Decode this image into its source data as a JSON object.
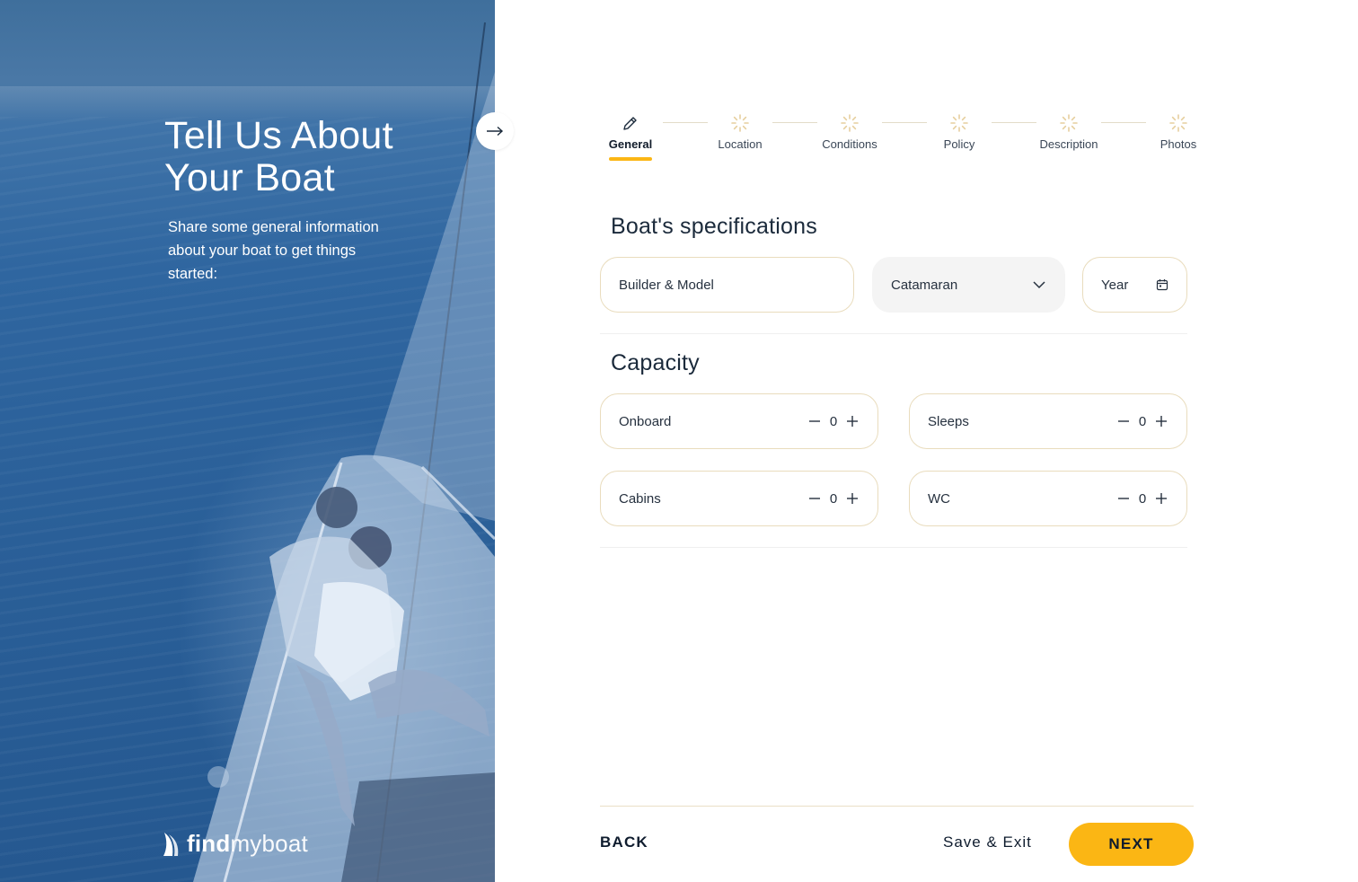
{
  "hero": {
    "title": "Tell Us About Your Boat",
    "subtitle": "Share some general information about your boat to get things started:",
    "logo_bold": "find",
    "logo_light": "myboat"
  },
  "stepper": {
    "steps": [
      {
        "label": "General",
        "state": "active",
        "icon": "pencil-icon"
      },
      {
        "label": "Location",
        "state": "pending",
        "icon": "loading-icon"
      },
      {
        "label": "Conditions",
        "state": "pending",
        "icon": "loading-icon"
      },
      {
        "label": "Policy",
        "state": "pending",
        "icon": "loading-icon"
      },
      {
        "label": "Description",
        "state": "pending",
        "icon": "loading-icon"
      },
      {
        "label": "Photos",
        "state": "pending",
        "icon": "loading-icon"
      }
    ]
  },
  "specs": {
    "title": "Boat's specifications",
    "builder_placeholder": "Builder & Model",
    "type_value": "Catamaran",
    "year_placeholder": "Year"
  },
  "capacity": {
    "title": "Capacity",
    "items": [
      {
        "label": "Onboard",
        "value": "0"
      },
      {
        "label": "Sleeps",
        "value": "0"
      },
      {
        "label": "Cabins",
        "value": "0"
      },
      {
        "label": "WC",
        "value": "0"
      }
    ]
  },
  "footer": {
    "back": "BACK",
    "save_exit": "Save & Exit",
    "next": "NEXT"
  },
  "colors": {
    "accent": "#fbb614",
    "hero_blue": "#2f66a0",
    "text_dark": "#0f1c2e",
    "field_border": "#e9dcbd"
  }
}
